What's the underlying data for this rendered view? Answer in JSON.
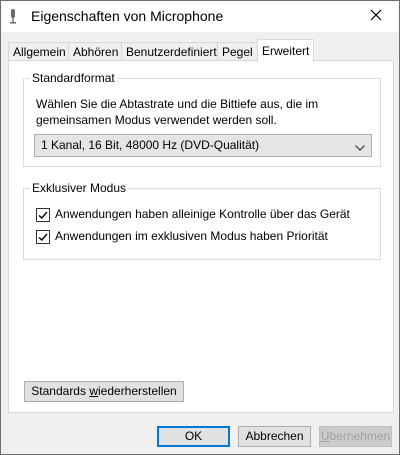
{
  "window": {
    "title": "Eigenschaften von Microphone",
    "icon": "microphone-icon",
    "close_icon": "close-icon"
  },
  "tabs": [
    {
      "label": "Allgemein",
      "active": false
    },
    {
      "label": "Abhören",
      "active": false
    },
    {
      "label": "Benutzerdefiniert",
      "active": false
    },
    {
      "label": "Pegel",
      "active": false
    },
    {
      "label": "Erweitert",
      "active": true
    }
  ],
  "standardformat": {
    "heading": "Standardformat",
    "description": "Wählen Sie die Abtastrate und die Bittiefe aus, die im gemeinsamen Modus verwendet werden soll.",
    "selected": "1 Kanal, 16 Bit, 48000 Hz (DVD-Qualität)"
  },
  "exclusive": {
    "heading": "Exklusiver Modus",
    "options": [
      {
        "label": "Anwendungen haben alleinige Kontrolle über das Gerät",
        "checked": true
      },
      {
        "label": "Anwendungen im exklusiven Modus haben Priorität",
        "checked": true
      }
    ]
  },
  "restore_button": {
    "label_before": "Standards ",
    "label_underlined": "w",
    "label_after": "iederherstellen"
  },
  "footer": {
    "ok": "OK",
    "cancel": "Abbrechen",
    "apply_underlined": "Ü",
    "apply_rest": "bernehmen"
  },
  "colors": {
    "accent": "#0078d7",
    "panel_bg": "#ffffff",
    "window_bg": "#f0f0f0"
  }
}
